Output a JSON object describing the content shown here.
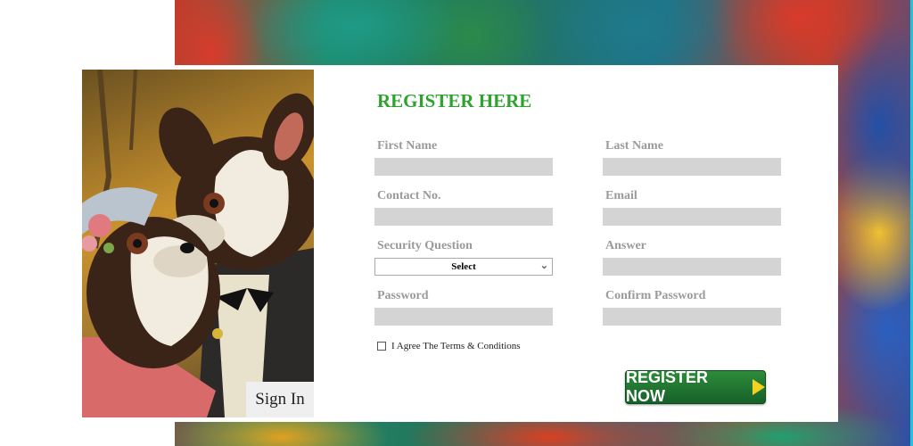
{
  "form": {
    "title": "REGISTER HERE",
    "first_name_label": "First Name",
    "last_name_label": "Last Name",
    "contact_label": "Contact No.",
    "email_label": "Email",
    "security_question_label": "Security Question",
    "security_question_value": "Select",
    "answer_label": "Answer",
    "password_label": "Password",
    "confirm_password_label": "Confirm Password",
    "terms_label": "I Agree The Terms & Conditions",
    "register_button": "REGISTER NOW",
    "sign_in_button": "Sign In"
  },
  "colors": {
    "title": "#2ea12e",
    "register_button": "#1f7a32",
    "input_fill": "#d4d4d4"
  }
}
